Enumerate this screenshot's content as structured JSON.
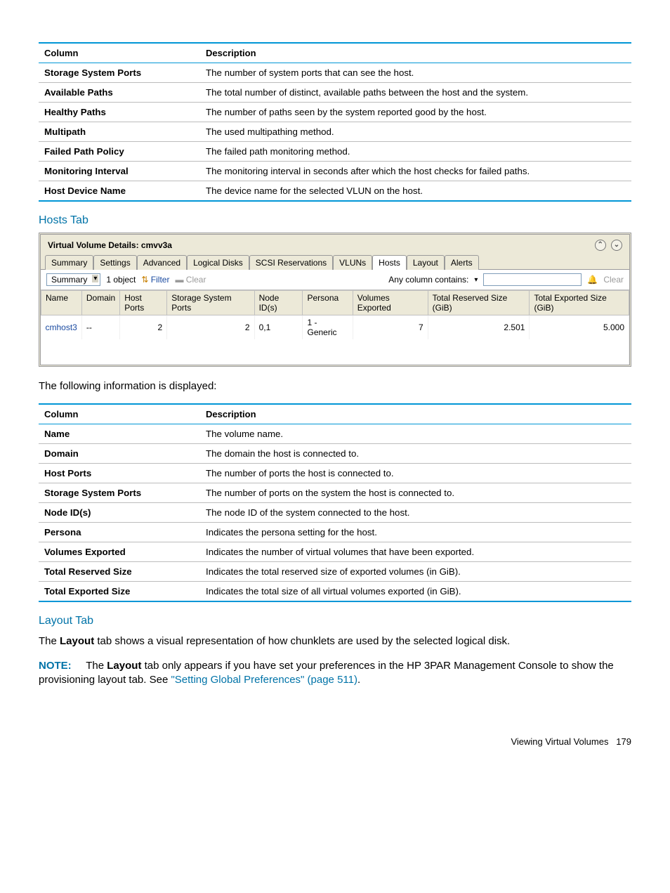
{
  "table1": {
    "header": [
      "Column",
      "Description"
    ],
    "rows": [
      [
        "Storage System Ports",
        "The number of system ports that can see the host."
      ],
      [
        "Available Paths",
        "The total number of distinct, available paths between the host and the system."
      ],
      [
        "Healthy Paths",
        "The number of paths seen by the system reported good by the host."
      ],
      [
        "Multipath",
        "The used multipathing method."
      ],
      [
        "Failed Path Policy",
        "The failed path monitoring method."
      ],
      [
        "Monitoring Interval",
        "The monitoring interval in seconds after which the host checks for failed paths."
      ],
      [
        "Host Device Name",
        "The device name for the selected VLUN on the host."
      ]
    ]
  },
  "hosts_heading": "Hosts Tab",
  "shot": {
    "title": "Virtual Volume Details: cmvv3a",
    "tabs": [
      "Summary",
      "Settings",
      "Advanced",
      "Logical Disks",
      "SCSI Reservations",
      "VLUNs",
      "Hosts",
      "Layout",
      "Alerts"
    ],
    "active_tab": "Hosts",
    "toolbar": {
      "view": "Summary",
      "count": "1 object",
      "filter": "Filter",
      "clear1": "Clear",
      "contains_label": "Any column contains:",
      "clear2": "Clear"
    },
    "columns": [
      "Name",
      "Domain",
      "Host Ports",
      "Storage System Ports",
      "Node ID(s)",
      "Persona",
      "Volumes Exported",
      "Total Reserved Size (GiB)",
      "Total Exported Size (GiB)"
    ],
    "row": [
      "cmhost3",
      "--",
      "2",
      "2",
      "0,1",
      "1 - Generic",
      "7",
      "2.501",
      "5.000"
    ]
  },
  "info_line": "The following information is displayed:",
  "table2": {
    "header": [
      "Column",
      "Description"
    ],
    "rows": [
      [
        "Name",
        "The volume name."
      ],
      [
        "Domain",
        "The domain the host is connected to."
      ],
      [
        "Host Ports",
        "The number of ports the host is connected to."
      ],
      [
        "Storage System Ports",
        "The number of ports on the system the host is connected to."
      ],
      [
        "Node ID(s)",
        "The node ID of the system connected to the host."
      ],
      [
        "Persona",
        "Indicates the persona setting for the host."
      ],
      [
        "Volumes Exported",
        "Indicates the number of virtual volumes that have been exported."
      ],
      [
        "Total Reserved Size",
        "Indicates the total reserved size of exported volumes (in GiB)."
      ],
      [
        "Total Exported Size",
        "Indicates the total size of all virtual volumes exported (in GiB)."
      ]
    ]
  },
  "layout_heading": "Layout Tab",
  "layout_text_pre": "The ",
  "layout_text_bold": "Layout",
  "layout_text_post": " tab shows a visual representation of how chunklets are used by the selected logical disk.",
  "note_label": "NOTE:",
  "note_pre": "The ",
  "note_bold": "Layout",
  "note_mid": " tab only appears if you have set your preferences in the HP 3PAR Management Console to show the provisioning layout tab. See ",
  "note_link": "\"Setting Global Preferences\" (page 511)",
  "note_end": ".",
  "footer_text": "Viewing Virtual Volumes",
  "footer_page": "179"
}
